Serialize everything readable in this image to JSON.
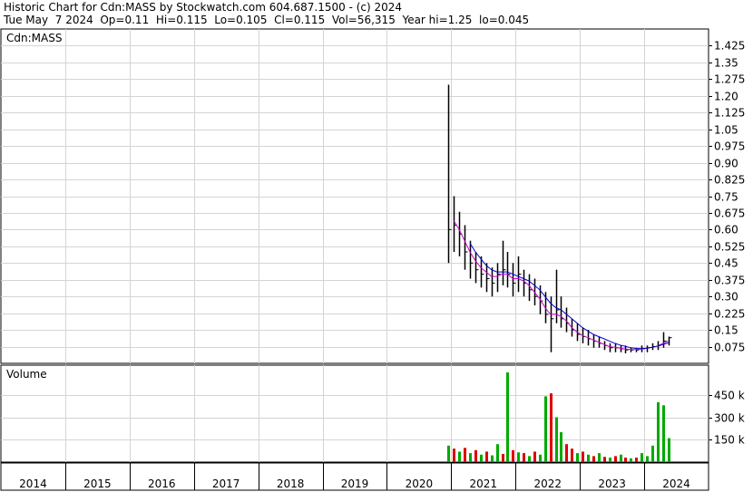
{
  "header": {
    "line1": "Historic Chart for Cdn:MASS by Stockwatch.com 604.687.1500 - (c) 2024",
    "line2": "Tue May  7 2024  Op=0.11  Hi=0.115  Lo=0.105  Cl=0.115  Vol=56,315  Year hi=1.25  lo=0.045"
  },
  "chart_data": [
    {
      "type": "line",
      "title": "Cdn:MASS",
      "ylim": [
        0,
        1.5
      ],
      "y_ticks": [
        "1.425",
        "1.35",
        "1.275",
        "1.20",
        "1.125",
        "1.05",
        "0.975",
        "0.90",
        "0.825",
        "0.75",
        "0.675",
        "0.60",
        "0.525",
        "0.45",
        "0.375",
        "0.30",
        "0.225",
        "0.15",
        "0.075"
      ],
      "x_ticks": [
        "2014",
        "2015",
        "2016",
        "2017",
        "2018",
        "2019",
        "2020",
        "2021",
        "2022",
        "2023",
        "2024"
      ],
      "grid": true,
      "series": [
        {
          "kind": "high-low-close bars",
          "color": "#000000",
          "x": [
            "2020-12",
            "2021-01",
            "2021-02",
            "2021-03",
            "2021-04",
            "2021-05",
            "2021-06",
            "2021-07",
            "2021-08",
            "2021-09",
            "2021-10",
            "2021-11",
            "2021-12",
            "2022-01",
            "2022-02",
            "2022-03",
            "2022-04",
            "2022-05",
            "2022-06",
            "2022-07",
            "2022-08",
            "2022-09",
            "2022-10",
            "2022-11",
            "2022-12",
            "2023-01",
            "2023-02",
            "2023-03",
            "2023-04",
            "2023-05",
            "2023-06",
            "2023-07",
            "2023-08",
            "2023-09",
            "2023-10",
            "2023-11",
            "2023-12",
            "2024-01",
            "2024-02",
            "2024-03",
            "2024-04",
            "2024-05"
          ],
          "high": [
            1.25,
            0.75,
            0.68,
            0.62,
            0.55,
            0.5,
            0.48,
            0.45,
            0.43,
            0.45,
            0.55,
            0.5,
            0.45,
            0.48,
            0.42,
            0.4,
            0.38,
            0.35,
            0.32,
            0.3,
            0.42,
            0.3,
            0.25,
            0.2,
            0.18,
            0.16,
            0.15,
            0.13,
            0.12,
            0.1,
            0.09,
            0.09,
            0.08,
            0.08,
            0.07,
            0.07,
            0.08,
            0.08,
            0.09,
            0.1,
            0.14,
            0.12
          ],
          "low": [
            0.45,
            0.5,
            0.48,
            0.42,
            0.38,
            0.36,
            0.34,
            0.32,
            0.3,
            0.32,
            0.35,
            0.34,
            0.3,
            0.32,
            0.3,
            0.28,
            0.26,
            0.22,
            0.18,
            0.05,
            0.18,
            0.16,
            0.14,
            0.12,
            0.1,
            0.09,
            0.08,
            0.07,
            0.07,
            0.06,
            0.05,
            0.05,
            0.05,
            0.045,
            0.05,
            0.05,
            0.05,
            0.05,
            0.06,
            0.06,
            0.07,
            0.08
          ],
          "close": [
            0.6,
            0.62,
            0.58,
            0.5,
            0.45,
            0.42,
            0.4,
            0.38,
            0.36,
            0.4,
            0.42,
            0.4,
            0.36,
            0.4,
            0.36,
            0.33,
            0.3,
            0.28,
            0.22,
            0.2,
            0.24,
            0.2,
            0.18,
            0.15,
            0.13,
            0.12,
            0.11,
            0.1,
            0.09,
            0.08,
            0.07,
            0.07,
            0.065,
            0.06,
            0.06,
            0.06,
            0.065,
            0.07,
            0.075,
            0.08,
            0.1,
            0.115
          ]
        },
        {
          "kind": "moving average",
          "color": "#cc00cc",
          "values": [
            null,
            0.64,
            0.6,
            0.55,
            0.5,
            0.46,
            0.43,
            0.41,
            0.39,
            0.39,
            0.4,
            0.4,
            0.38,
            0.38,
            0.37,
            0.35,
            0.32,
            0.29,
            0.25,
            0.22,
            0.22,
            0.21,
            0.19,
            0.16,
            0.14,
            0.125,
            0.115,
            0.105,
            0.095,
            0.085,
            0.075,
            0.072,
            0.068,
            0.064,
            0.062,
            0.062,
            0.064,
            0.068,
            0.072,
            0.078,
            0.09,
            0.1
          ]
        },
        {
          "kind": "moving average",
          "color": "#0000cc",
          "values": [
            null,
            null,
            null,
            null,
            0.54,
            0.5,
            0.47,
            0.44,
            0.42,
            0.41,
            0.41,
            0.41,
            0.4,
            0.39,
            0.38,
            0.37,
            0.35,
            0.33,
            0.3,
            0.27,
            0.25,
            0.24,
            0.22,
            0.2,
            0.18,
            0.16,
            0.145,
            0.13,
            0.12,
            0.11,
            0.1,
            0.09,
            0.082,
            0.076,
            0.07,
            0.067,
            0.066,
            0.068,
            0.072,
            0.078,
            0.085,
            0.092
          ]
        }
      ]
    },
    {
      "type": "bar",
      "title": "Volume",
      "y_ticks": [
        "450 k",
        "300 k",
        "150 k"
      ],
      "ylim": [
        0,
        600
      ],
      "series": [
        {
          "name": "",
          "up_color": "#00aa00",
          "down_color": "#dd0000",
          "x": [
            "2020-12",
            "2021-01",
            "2021-02",
            "2021-03",
            "2021-04",
            "2021-05",
            "2021-06",
            "2021-07",
            "2021-08",
            "2021-09",
            "2021-10",
            "2021-11",
            "2021-12",
            "2022-01",
            "2022-02",
            "2022-03",
            "2022-04",
            "2022-05",
            "2022-06",
            "2022-07",
            "2022-08",
            "2022-09",
            "2022-10",
            "2022-11",
            "2022-12",
            "2023-01",
            "2023-02",
            "2023-03",
            "2023-04",
            "2023-05",
            "2023-06",
            "2023-07",
            "2023-08",
            "2023-09",
            "2023-10",
            "2023-11",
            "2023-12",
            "2024-01",
            "2024-02",
            "2024-03",
            "2024-04",
            "2024-05"
          ],
          "values": [
            110,
            90,
            70,
            95,
            60,
            80,
            50,
            70,
            45,
            120,
            55,
            600,
            80,
            65,
            60,
            40,
            70,
            50,
            440,
            460,
            300,
            200,
            120,
            90,
            60,
            70,
            50,
            40,
            60,
            35,
            30,
            40,
            50,
            30,
            25,
            30,
            60,
            40,
            110,
            400,
            380,
            160
          ],
          "up": [
            true,
            false,
            true,
            false,
            true,
            false,
            true,
            false,
            true,
            true,
            false,
            true,
            false,
            true,
            false,
            true,
            false,
            true,
            true,
            false,
            true,
            true,
            false,
            false,
            true,
            false,
            true,
            false,
            true,
            false,
            true,
            false,
            true,
            false,
            true,
            false,
            true,
            true,
            true,
            true,
            true,
            true
          ]
        }
      ]
    }
  ]
}
